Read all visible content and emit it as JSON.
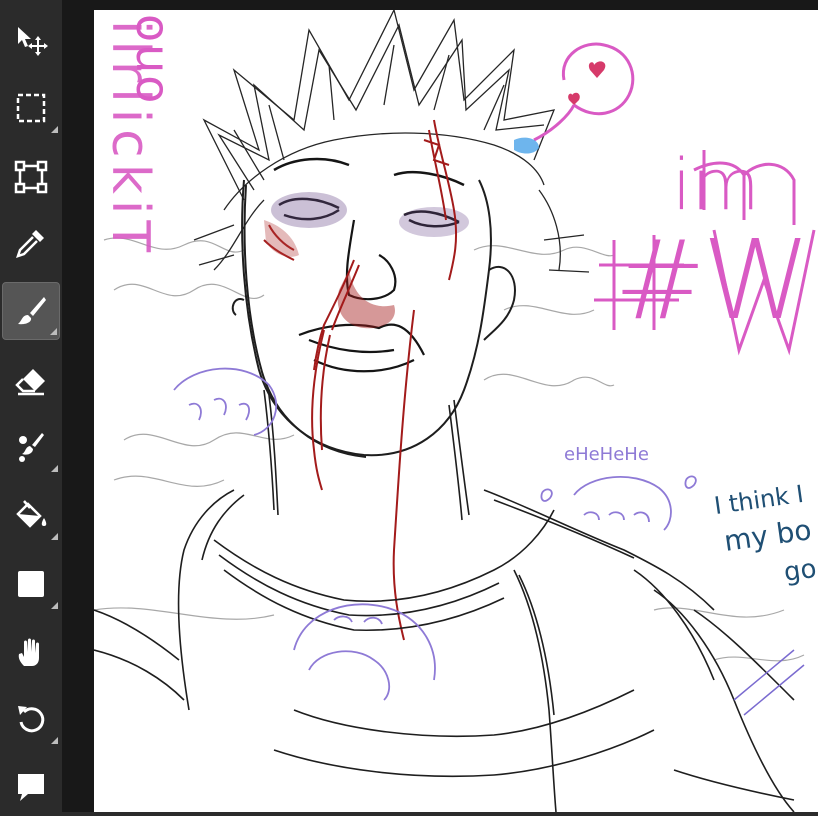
{
  "toolbar": {
    "tools": [
      {
        "name": "move-tool",
        "icon": "move-arrow-icon",
        "has_submenu": false
      },
      {
        "name": "marquee-select-tool",
        "icon": "dashed-rect-select-icon",
        "has_submenu": true
      },
      {
        "name": "transform-tool",
        "icon": "transform-box-icon",
        "has_submenu": false
      },
      {
        "name": "eyedropper-tool",
        "icon": "eyedropper-icon",
        "has_submenu": false
      },
      {
        "name": "brush-tool",
        "icon": "paintbrush-icon",
        "has_submenu": true,
        "active": true
      },
      {
        "name": "eraser-tool",
        "icon": "eraser-icon",
        "has_submenu": false
      },
      {
        "name": "smudge-tool",
        "icon": "smudge-brushes-icon",
        "has_submenu": true
      },
      {
        "name": "fill-tool",
        "icon": "paint-bucket-icon",
        "has_submenu": true
      },
      {
        "name": "shape-tool",
        "icon": "rectangle-shape-icon",
        "has_submenu": true
      },
      {
        "name": "hand-tool",
        "icon": "hand-icon",
        "has_submenu": false
      },
      {
        "name": "undo-tool",
        "icon": "undo-icon",
        "has_submenu": true
      },
      {
        "name": "comment-tool",
        "icon": "speech-bubble-icon",
        "has_submenu": false
      }
    ]
  },
  "colors": {
    "toolbar_bg": "#2b2b2b",
    "active_tool_bg": "#555555",
    "icon": "#ffffff",
    "canvas_bg": "#ffffff",
    "sketch_ink": "#1e1e1e",
    "blood_red": "#a31b1b",
    "bruise_purple": "#6a4a8a",
    "doodle_pink": "#d95ac4",
    "doodle_lavender": "#8e7ad6",
    "doodle_teal": "#1f4f74"
  },
  "canvas": {
    "vertical_text_upper": "ouo",
    "vertical_text_left": "ilrlickiT",
    "pink_text_line1": "im",
    "pink_text_line2": "#W",
    "lavender_laugh": "eHeHeHe",
    "teal_text": [
      "I think I",
      "my bo",
      "go"
    ]
  }
}
